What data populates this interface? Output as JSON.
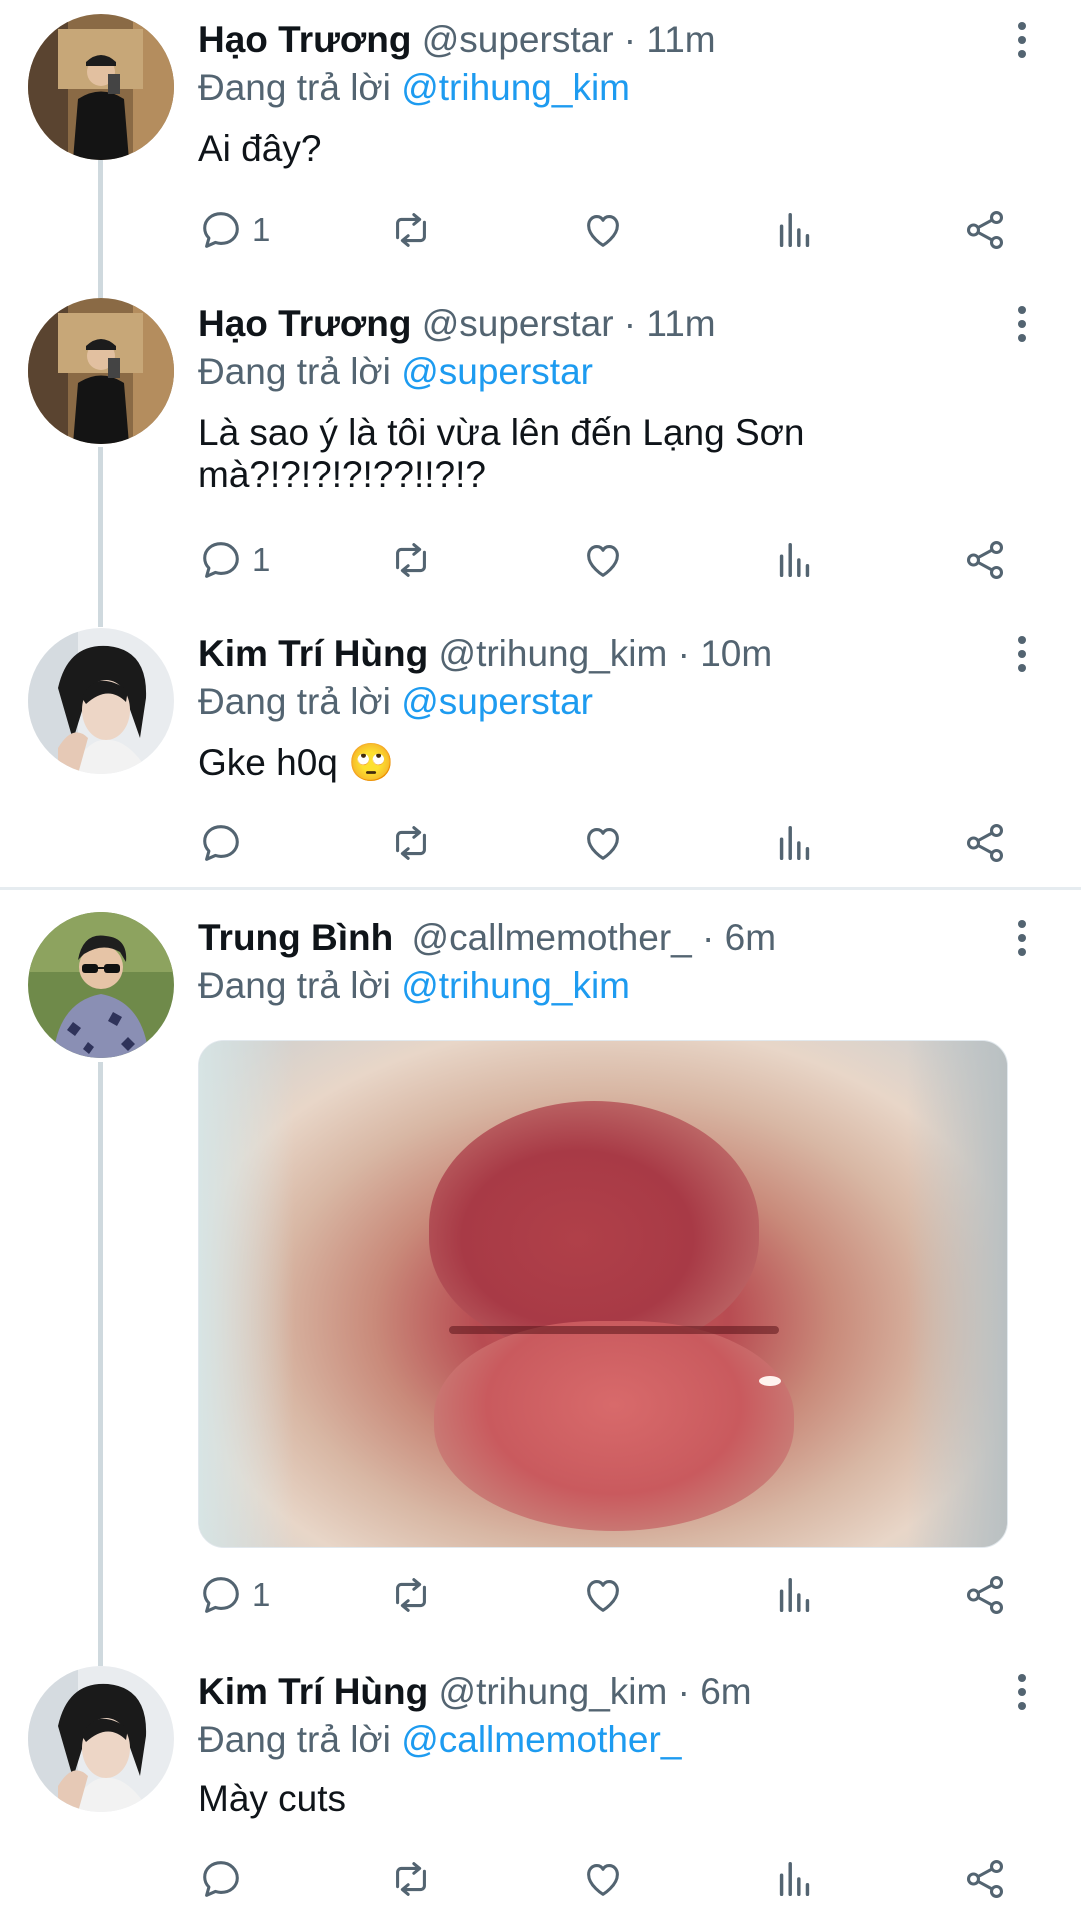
{
  "replying_prefix": "Đang trả lời",
  "colors": {
    "accent": "#1d9bf0",
    "muted": "#536471",
    "text": "#0f1419",
    "thread_line": "#cfd9de"
  },
  "tweets": [
    {
      "name": "Hạo Trương",
      "handle": "@superstar",
      "time": "· 11m",
      "reply_to": "@trihung_kim",
      "text": "Ai đây?",
      "reply_count": "1",
      "avatar_icon": "person-in-suit-avatar"
    },
    {
      "name": "Hạo Trương",
      "handle": "@superstar",
      "time": "· 11m",
      "reply_to": "@superstar",
      "text_line1": "Là sao ý là tôi vừa lên đến Lạng Sơn",
      "text_line2": "mà?!?!?!?!??!!?!?",
      "reply_count": "1",
      "avatar_icon": "person-in-suit-avatar"
    },
    {
      "name": "Kim Trí Hùng",
      "handle": "@trihung_kim",
      "time": "· 10m",
      "reply_to": "@superstar",
      "text": "Gke h0q",
      "emoji": "🙄",
      "reply_count": "",
      "avatar_icon": "dark-hair-portrait-avatar"
    },
    {
      "name": "Trung Bình",
      "handle": "@callmemother_",
      "time": "· 6m",
      "reply_to": "@trihung_kim",
      "media": "lips-closeup-photo",
      "reply_count": "1",
      "avatar_icon": "sunglasses-portrait-avatar"
    },
    {
      "name": "Kim Trí Hùng",
      "handle": "@trihung_kim",
      "time": "· 6m",
      "reply_to": "@callmemother_",
      "text": "Mày cuts",
      "reply_count": "",
      "avatar_icon": "dark-hair-portrait-avatar"
    }
  ]
}
